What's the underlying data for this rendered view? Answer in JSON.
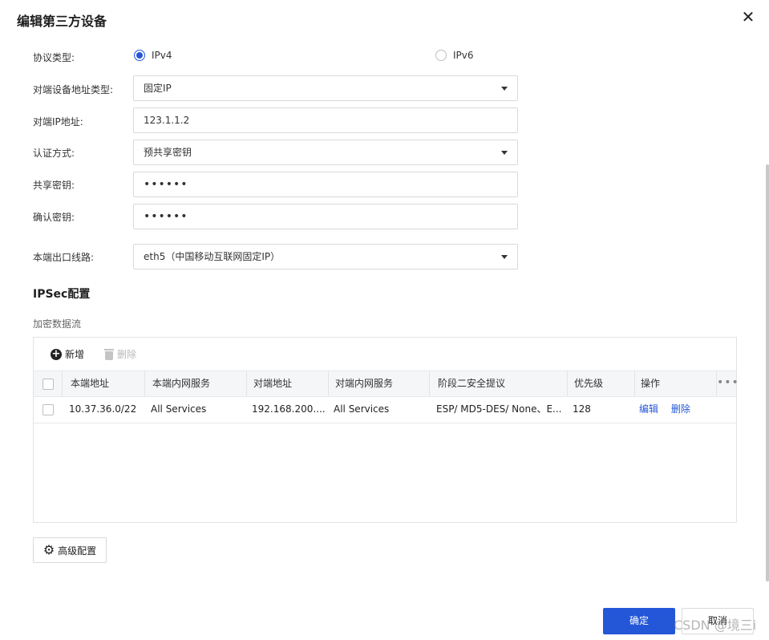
{
  "dialog": {
    "title": "编辑第三方设备",
    "close": "✕"
  },
  "form": {
    "protocol_label": "协议类型:",
    "protocol_options": [
      "IPv4",
      "IPv6"
    ],
    "protocol_selected": "IPv4",
    "peer_addr_type_label": "对端设备地址类型:",
    "peer_addr_type_value": "固定IP",
    "peer_ip_label": "对端IP地址:",
    "peer_ip_value": "123.1.1.2",
    "auth_label": "认证方式:",
    "auth_value": "预共享密钥",
    "shared_key_label": "共享密钥:",
    "shared_key_value": "••••••",
    "confirm_key_label": "确认密钥:",
    "confirm_key_value": "••••••",
    "egress_label": "本端出口线路:",
    "egress_value": "eth5（中国移动互联网固定IP）"
  },
  "ipsec": {
    "title": "IPSec配置",
    "subtitle": "加密数据流",
    "toolbar": {
      "add": "新增",
      "delete": "删除"
    },
    "columns": [
      "本端地址",
      "本端内网服务",
      "对端地址",
      "对端内网服务",
      "阶段二安全提议",
      "优先级",
      "操作"
    ],
    "rows": [
      {
        "local_addr": "10.37.36.0/22",
        "local_service": "All Services",
        "peer_addr": "192.168.200....",
        "peer_service": "All Services",
        "proposal": "ESP/ MD5-DES/ None、E...",
        "priority": "128",
        "actions": [
          "编辑",
          "删除"
        ]
      }
    ]
  },
  "advanced_button": "高级配置",
  "footer": {
    "ok": "确定",
    "cancel": "取消"
  },
  "watermark": "CSDN @境三i",
  "colors": {
    "primary": "#2457d8",
    "border": "#d9d9d9",
    "header_bg": "#f5f6f8"
  },
  "icons": [
    "close-icon",
    "plus-circle-icon",
    "trash-icon",
    "gear-icon",
    "chevron-down-icon",
    "more-icon"
  ]
}
